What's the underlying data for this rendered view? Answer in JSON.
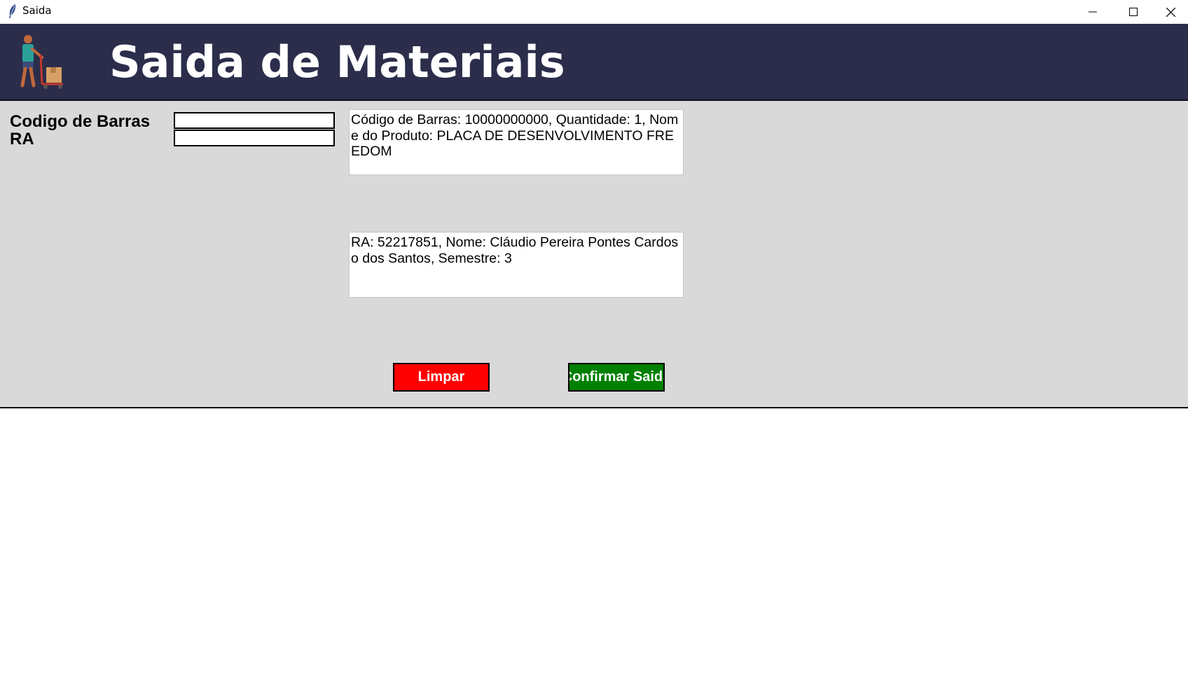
{
  "window": {
    "title": "Saida",
    "controls": [
      "minimize-icon",
      "maximize-icon",
      "close-icon"
    ]
  },
  "header": {
    "title": "Saida de Materiais",
    "background": "#2b2d4b",
    "logo": "delivery-worker-with-cart-icon"
  },
  "form": {
    "barcode_label": "Codigo de Barras",
    "ra_label": "RA",
    "barcode_value": "",
    "ra_value": ""
  },
  "product_info": "Código de Barras: 10000000000, Quantidade: 1, Nome do Produto: PLACA DE DESENVOLVIMENTO FREEDOM",
  "student_info": "RA: 52217851, Nome: Cláudio Pereira Pontes Cardoso dos Santos, Semestre: 3",
  "buttons": {
    "clear_label": "Limpar",
    "clear_color": "#ff0000",
    "confirm_label": "Confirmar Saida",
    "confirm_color": "#008000"
  }
}
